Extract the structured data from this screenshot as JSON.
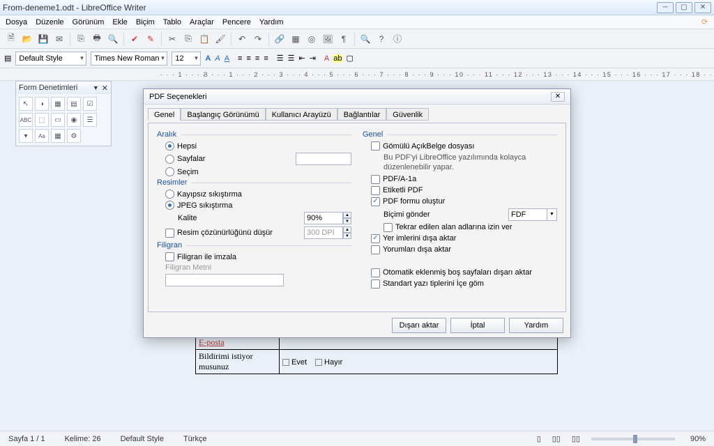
{
  "window": {
    "title": "From-deneme1.odt - LibreOffice Writer"
  },
  "menu": [
    "Dosya",
    "Düzenle",
    "Görünüm",
    "Ekle",
    "Biçim",
    "Tablo",
    "Araçlar",
    "Pencere",
    "Yardım"
  ],
  "style_combo": "Default Style",
  "font_combo": "Times New Roman",
  "size_combo": "12",
  "ruler": "· · · 1 · · · Ϩ · · · 1 · · · 2 · · · 3 · · · 4 · · · 5 · · · 6 · · · 7 · · · 8 · · · 9 · · · 10 · · · 11 · · · 12 · · · 13 · · · 14 · · · 15 · · · 16 · · · 17 · · · 18 · · ·",
  "formpanel": {
    "title": "Form Denetimleri"
  },
  "dialog": {
    "title": "PDF Seçenekleri",
    "tabs": [
      "Genel",
      "Başlangıç Görünümü",
      "Kullanıcı Arayüzü",
      "Bağlantılar",
      "Güvenlik"
    ],
    "left": {
      "aralik": "Aralık",
      "hepsi": "Hepsi",
      "sayfalar": "Sayfalar",
      "secim": "Seçim",
      "resimler": "Resimler",
      "kayipsiz": "Kayıpsız sıkıştırma",
      "jpeg": "JPEG sıkıştırma",
      "kalite": "Kalite",
      "kalite_val": "90%",
      "cozunurluk": "Resim çözünürlüğünü düşür",
      "dpi": "300 DPI",
      "filigran": "Filigran",
      "filigran_imzala": "Filigran ile imzala",
      "filigran_metni": "Filigran Metni"
    },
    "right": {
      "genel": "Genel",
      "gomulu": "Gömülü AçıkBelge dosyası",
      "gomulu_desc": "Bu PDF'yi LibreOffice yazılımında kolayca düzenlenebilir yapar.",
      "pdfa": "PDF/A-1a",
      "etiketli": "Etiketli PDF",
      "form": "PDF formu oluştur",
      "bicimi": "Biçimi gönder",
      "bicimi_val": "FDF",
      "tekrar": "Tekrar edilen alan adlarına izin ver",
      "yerim": "Yer imlerini dışa aktar",
      "yorum": "Yorumları dışa aktar",
      "otomatik": "Otomatik eklenmiş boş sayfaları dışarı aktar",
      "standart": "Standart yazı tiplerini İçe göm"
    },
    "buttons": {
      "export": "Dışarı aktar",
      "cancel": "İptal",
      "help": "Yardım"
    }
  },
  "doc": {
    "r1c1": "E-posta",
    "r2c1": "Bildirimi istiyor musunuz",
    "evet": "Evet",
    "hayir": "Hayır"
  },
  "status": {
    "page": "Sayfa 1 / 1",
    "words": "Kelime: 26",
    "style": "Default Style",
    "lang": "Türkçe",
    "zoom": "90%"
  }
}
